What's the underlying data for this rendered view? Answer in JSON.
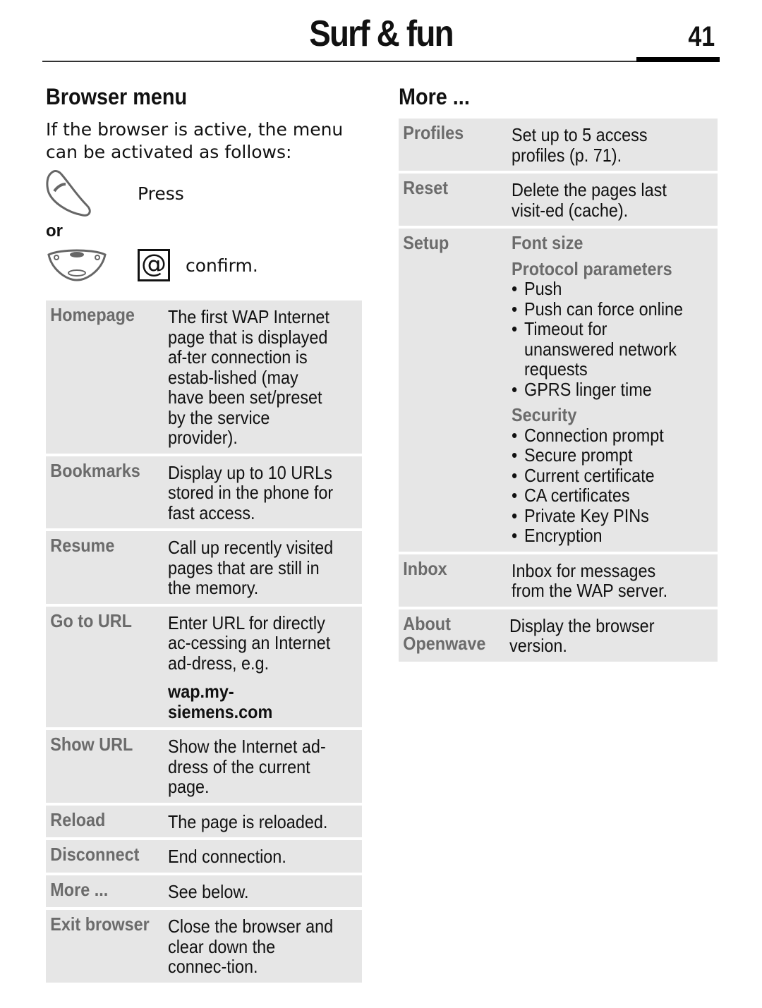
{
  "header": {
    "title": "Surf & fun",
    "page_number": "41"
  },
  "browser_menu": {
    "title": "Browser menu",
    "intro": "If the browser is active, the menu can be activated as follows:",
    "press_label": "Press",
    "or_label": "or",
    "confirm_label": "confirm.",
    "icons": {
      "end_key": "phone-end-key-icon",
      "control_key": "control-key-icon",
      "at_key": "at-softkey-icon"
    },
    "items": [
      {
        "label": "Homepage",
        "description": "The first WAP Internet page that is displayed af-ter connection is estab-lished (may have been set/preset by the service provider)."
      },
      {
        "label": "Bookmarks",
        "description": "Display up to 10 URLs stored in the phone for fast access."
      },
      {
        "label": "Resume",
        "description": "Call up recently visited pages that are still in the memory."
      },
      {
        "label": "Go to URL",
        "description": "Enter URL for directly ac-cessing an Internet ad-dress, e.g.",
        "extra": "wap.my-siemens.com"
      },
      {
        "label": "Show URL",
        "description": "Show the Internet ad-dress of the current page."
      },
      {
        "label": "Reload",
        "description": "The page is reloaded."
      },
      {
        "label": "Disconnect",
        "description": "End connection."
      },
      {
        "label": "More ...",
        "description": "See below."
      },
      {
        "label": "Exit browser",
        "description": "Close the browser and clear down the connec-tion."
      }
    ]
  },
  "more": {
    "title": "More ...",
    "items": [
      {
        "label": "Profiles",
        "description": "Set up to 5 access profiles (p. 71)."
      },
      {
        "label": "Reset",
        "description": "Delete the pages last visit-ed (cache)."
      },
      {
        "label": "Setup",
        "font_size": "Font size",
        "protocol_title": "Protocol parameters",
        "protocol_items": [
          "Push",
          "Push can force online",
          "Timeout for unanswered network requests",
          "GPRS linger time"
        ],
        "security_title": "Security",
        "security_items": [
          "Connection prompt",
          "Secure prompt",
          "Current certificate",
          "CA certificates",
          "Private Key PINs",
          "Encryption"
        ]
      },
      {
        "label": "Inbox",
        "description": "Inbox for messages from the WAP server."
      },
      {
        "label": "About Openwave",
        "description": "Display the browser version."
      }
    ]
  },
  "colors": {
    "table_bg": "#e6e6e6",
    "label_gray": "#6b6b6b"
  }
}
